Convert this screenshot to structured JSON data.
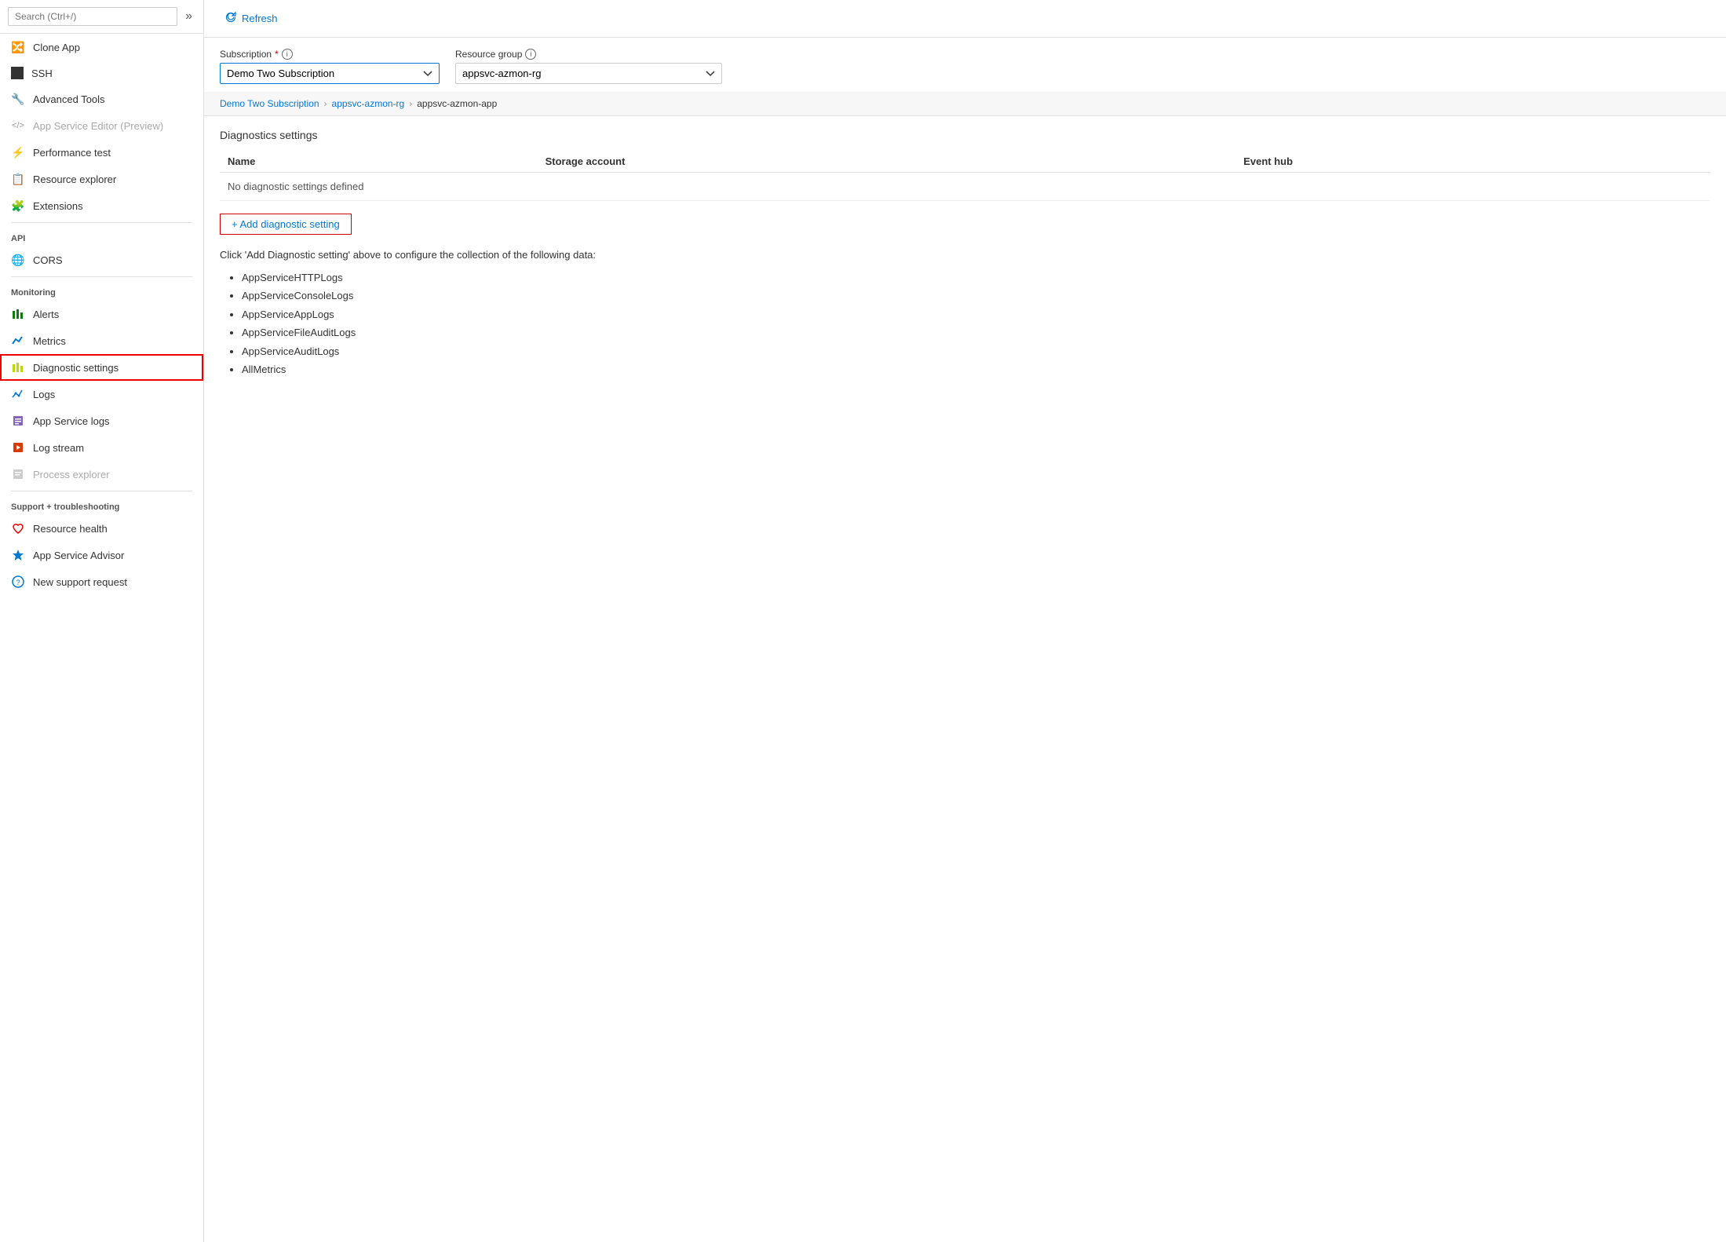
{
  "sidebar": {
    "search_placeholder": "Search (Ctrl+/)",
    "items": [
      {
        "id": "clone-app",
        "label": "Clone App",
        "icon": "🔀",
        "iconColor": "teal",
        "disabled": false
      },
      {
        "id": "ssh",
        "label": "SSH",
        "icon": "⬛",
        "iconColor": "dark",
        "disabled": false
      },
      {
        "id": "advanced-tools",
        "label": "Advanced Tools",
        "icon": "🔧",
        "iconColor": "blue",
        "disabled": false
      },
      {
        "id": "app-service-editor",
        "label": "App Service Editor (Preview)",
        "icon": "</>",
        "iconColor": "gray",
        "disabled": true
      },
      {
        "id": "performance-test",
        "label": "Performance test",
        "icon": "⚡",
        "iconColor": "green",
        "disabled": false
      },
      {
        "id": "resource-explorer",
        "label": "Resource explorer",
        "icon": "📋",
        "iconColor": "blue",
        "disabled": false
      },
      {
        "id": "extensions",
        "label": "Extensions",
        "icon": "🧩",
        "iconColor": "purple",
        "disabled": false
      }
    ],
    "sections": [
      {
        "label": "API",
        "items": [
          {
            "id": "cors",
            "label": "CORS",
            "icon": "🌐",
            "iconColor": "green",
            "disabled": false
          }
        ]
      },
      {
        "label": "Monitoring",
        "items": [
          {
            "id": "alerts",
            "label": "Alerts",
            "icon": "📊",
            "iconColor": "green",
            "disabled": false
          },
          {
            "id": "metrics",
            "label": "Metrics",
            "icon": "📈",
            "iconColor": "blue",
            "disabled": false
          },
          {
            "id": "diagnostic-settings",
            "label": "Diagnostic settings",
            "icon": "📊",
            "iconColor": "lime",
            "disabled": false,
            "active": true
          },
          {
            "id": "logs",
            "label": "Logs",
            "icon": "📉",
            "iconColor": "blue",
            "disabled": false
          },
          {
            "id": "app-service-logs",
            "label": "App Service logs",
            "icon": "📝",
            "iconColor": "purple",
            "disabled": false
          },
          {
            "id": "log-stream",
            "label": "Log stream",
            "icon": "🔄",
            "iconColor": "orange",
            "disabled": false
          },
          {
            "id": "process-explorer",
            "label": "Process explorer",
            "icon": "🖥",
            "iconColor": "gray",
            "disabled": true
          }
        ]
      },
      {
        "label": "Support + troubleshooting",
        "items": [
          {
            "id": "resource-health",
            "label": "Resource health",
            "icon": "❤",
            "iconColor": "red",
            "disabled": false
          },
          {
            "id": "app-service-advisor",
            "label": "App Service Advisor",
            "icon": "🏅",
            "iconColor": "blue",
            "disabled": false
          },
          {
            "id": "new-support-request",
            "label": "New support request",
            "icon": "🔵",
            "iconColor": "blue",
            "disabled": false
          }
        ]
      }
    ]
  },
  "toolbar": {
    "refresh_label": "Refresh"
  },
  "subscription": {
    "label": "Subscription",
    "required": true,
    "value": "Demo Two Subscription",
    "options": [
      "Demo Two Subscription"
    ]
  },
  "resource_group": {
    "label": "Resource group",
    "value": "appsvc-azmon-rg",
    "options": [
      "appsvc-azmon-rg"
    ]
  },
  "breadcrumb": {
    "parts": [
      {
        "label": "Demo Two Subscription",
        "link": true
      },
      {
        "label": "appsvc-azmon-rg",
        "link": true
      },
      {
        "label": "appsvc-azmon-app",
        "link": false
      }
    ]
  },
  "diagnostics": {
    "section_title": "Diagnostics settings",
    "columns": [
      "Name",
      "Storage account",
      "Event hub"
    ],
    "empty_message": "No diagnostic settings defined",
    "add_button_label": "+ Add diagnostic setting",
    "info_text": "Click 'Add Diagnostic setting' above to configure the collection of the following data:",
    "data_items": [
      "AppServiceHTTPLogs",
      "AppServiceConsoleLogs",
      "AppServiceAppLogs",
      "AppServiceFileAuditLogs",
      "AppServiceAuditLogs",
      "AllMetrics"
    ]
  }
}
